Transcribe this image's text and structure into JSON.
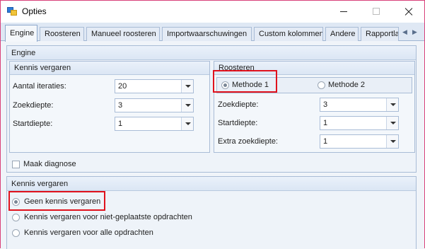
{
  "window": {
    "title": "Opties"
  },
  "tabs": [
    "Engine",
    "Roosteren",
    "Manueel roosteren",
    "Importwaarschuwingen",
    "Custom kolommen",
    "Andere",
    "Rapportla"
  ],
  "engine": {
    "header": "Engine",
    "kennis_vergaren": {
      "header": "Kennis vergaren",
      "fields": [
        {
          "label": "Aantal iteraties:",
          "value": "20"
        },
        {
          "label": "Zoekdiepte:",
          "value": "3"
        },
        {
          "label": "Startdiepte:",
          "value": "1"
        }
      ]
    },
    "roosteren": {
      "header": "Roosteren",
      "methods": [
        {
          "label": "Methode 1",
          "checked": true
        },
        {
          "label": "Methode 2",
          "checked": false
        }
      ],
      "fields": [
        {
          "label": "Zoekdiepte:",
          "value": "3"
        },
        {
          "label": "Startdiepte:",
          "value": "1"
        },
        {
          "label": "Extra zoekdiepte:",
          "value": "1"
        }
      ]
    },
    "maak_diagnose": {
      "label": "Maak diagnose",
      "checked": false
    }
  },
  "kennis_section": {
    "header": "Kennis vergaren",
    "options": [
      {
        "label": "Geen kennis vergaren",
        "checked": true
      },
      {
        "label": "Kennis vergaren voor niet-geplaatste opdrachten",
        "checked": false
      },
      {
        "label": "Kennis vergaren voor alle opdrachten",
        "checked": false
      }
    ]
  },
  "colors": {
    "highlight": "#e0121d",
    "window_border": "#d9417a"
  }
}
